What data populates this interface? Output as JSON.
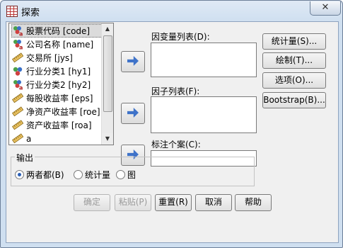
{
  "window": {
    "title": "探索",
    "close_glyph": "✕"
  },
  "variables": [
    {
      "label": "股票代码 [code]",
      "icon": "nominal-string-icon",
      "selected": true
    },
    {
      "label": "公司名称 [name]",
      "icon": "nominal-string-icon"
    },
    {
      "label": "交易所 [jys]",
      "icon": "scale-ruler-icon"
    },
    {
      "label": "行业分类1 [hy1]",
      "icon": "nominal-icon"
    },
    {
      "label": "行业分类2 [hy2]",
      "icon": "nominal-string-icon"
    },
    {
      "label": "每股收益率 [eps]",
      "icon": "scale-ruler-icon"
    },
    {
      "label": "净资产收益率 [roe]",
      "icon": "scale-ruler-icon"
    },
    {
      "label": "资产收益率 [roa]",
      "icon": "scale-ruler-icon"
    },
    {
      "label": "a",
      "icon": "scale-ruler-icon"
    }
  ],
  "fields": {
    "dependent_label": "因变量列表(D):",
    "factor_label": "因子列表(F):",
    "label_cases_label": "标注个案(C):"
  },
  "side_buttons": {
    "statistics": "统计量(S)...",
    "plots": "绘制(T)...",
    "options": "选项(O)...",
    "bootstrap": "Bootstrap(B)..."
  },
  "output": {
    "group_label": "输出",
    "both": "两者都(B)",
    "statistics": "统计量",
    "plots": "图",
    "selected": "both"
  },
  "bottom_buttons": {
    "ok": "确定",
    "paste": "粘贴(P)",
    "reset": "重置(R)",
    "cancel": "取消",
    "help": "帮助"
  }
}
